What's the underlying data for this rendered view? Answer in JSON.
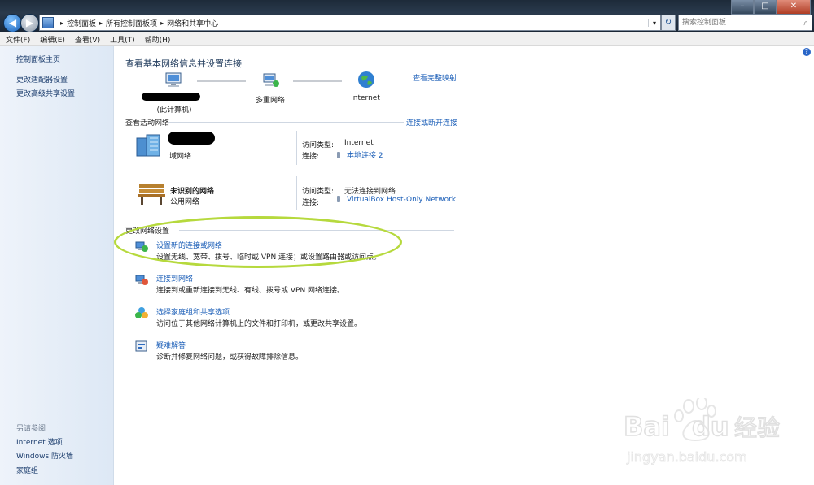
{
  "window": {
    "minimize": "–",
    "maximize": "□",
    "close": "✕"
  },
  "address": {
    "crumbs": [
      "控制面板",
      "所有控制面板项",
      "网络和共享中心"
    ],
    "separator": "▸",
    "dropdown": "▾",
    "refresh": "↻"
  },
  "search": {
    "placeholder": "搜索控制面板"
  },
  "menu": [
    "文件(F)",
    "编辑(E)",
    "查看(V)",
    "工具(T)",
    "帮助(H)"
  ],
  "left": {
    "home": "控制面板主页",
    "adapter": "更改适配器设置",
    "sharing": "更改高级共享设置",
    "see_also": "另请参阅",
    "internet_options": "Internet 选项",
    "firewall": "Windows 防火墙",
    "homegroup": "家庭组"
  },
  "main": {
    "help": "?",
    "title": "查看基本网络信息并设置连接",
    "full_map": "查看完整映射",
    "this_computer": "(此计算机)",
    "multi_network": "多重网络",
    "internet": "Internet",
    "active_networks": "查看活动网络",
    "connect_disconnect": "连接或断开连接",
    "net1": {
      "type": "域网络",
      "access_label": "访问类型:",
      "access_value": "Internet",
      "conn_label": "连接:",
      "conn_value": "本地连接 2"
    },
    "net2": {
      "name": "未识别的网络",
      "type": "公用网络",
      "access_label": "访问类型:",
      "access_value": "无法连接到网络",
      "conn_label": "连接:",
      "conn_value": "VirtualBox Host-Only Network"
    },
    "change_settings": "更改网络设置",
    "tasks": [
      {
        "title": "设置新的连接或网络",
        "desc": "设置无线、宽带、拨号、临时或 VPN 连接；或设置路由器或访问点。"
      },
      {
        "title": "连接到网络",
        "desc": "连接到或重新连接到无线、有线、拨号或 VPN 网络连接。"
      },
      {
        "title": "选择家庭组和共享选项",
        "desc": "访问位于其他网络计算机上的文件和打印机，或更改共享设置。"
      },
      {
        "title": "疑难解答",
        "desc": "诊断并修复网络问题，或获得故障排除信息。"
      }
    ]
  },
  "watermark": {
    "brand": "Bai",
    "brand2": "du",
    "cn": "经验",
    "url": "jingyan.baidu.com"
  },
  "colors": {
    "link": "#1c5fb8",
    "highlight": "#b6d93d"
  }
}
